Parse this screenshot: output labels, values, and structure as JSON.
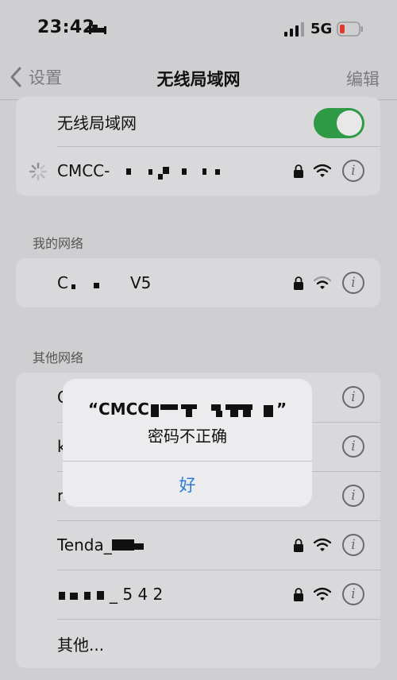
{
  "status": {
    "time": "23:42",
    "network": "5G",
    "icons": [
      "bed-icon",
      "cellular-signal-icon",
      "battery-low-icon"
    ],
    "battery_color": "#e0392b"
  },
  "nav": {
    "back_label": "设置",
    "title": "无线局域网",
    "edit_label": "编辑"
  },
  "wifi": {
    "toggle_label": "无线局域网",
    "toggle_on": true,
    "toggle_color": "#2f9a45",
    "current_network": "CMCC-",
    "current_status": "connecting"
  },
  "my_networks": {
    "section_title": "我的网络",
    "items": [
      {
        "name_start": "C",
        "name_end": "V5",
        "locked": true
      }
    ]
  },
  "other_networks": {
    "section_title": "其他网络",
    "items": [
      {
        "name": "C",
        "locked": true
      },
      {
        "name": "k",
        "locked": true
      },
      {
        "name": "n",
        "locked": true
      },
      {
        "name": "Tenda_",
        "locked": true
      },
      {
        "name": "_ 5 4 2",
        "locked": true
      }
    ],
    "other_label": "其他..."
  },
  "alert": {
    "title_start": "“CMCC",
    "title_end": "”",
    "message": "密码不正确",
    "button_label": "好",
    "button_color": "#2e7bd9"
  }
}
